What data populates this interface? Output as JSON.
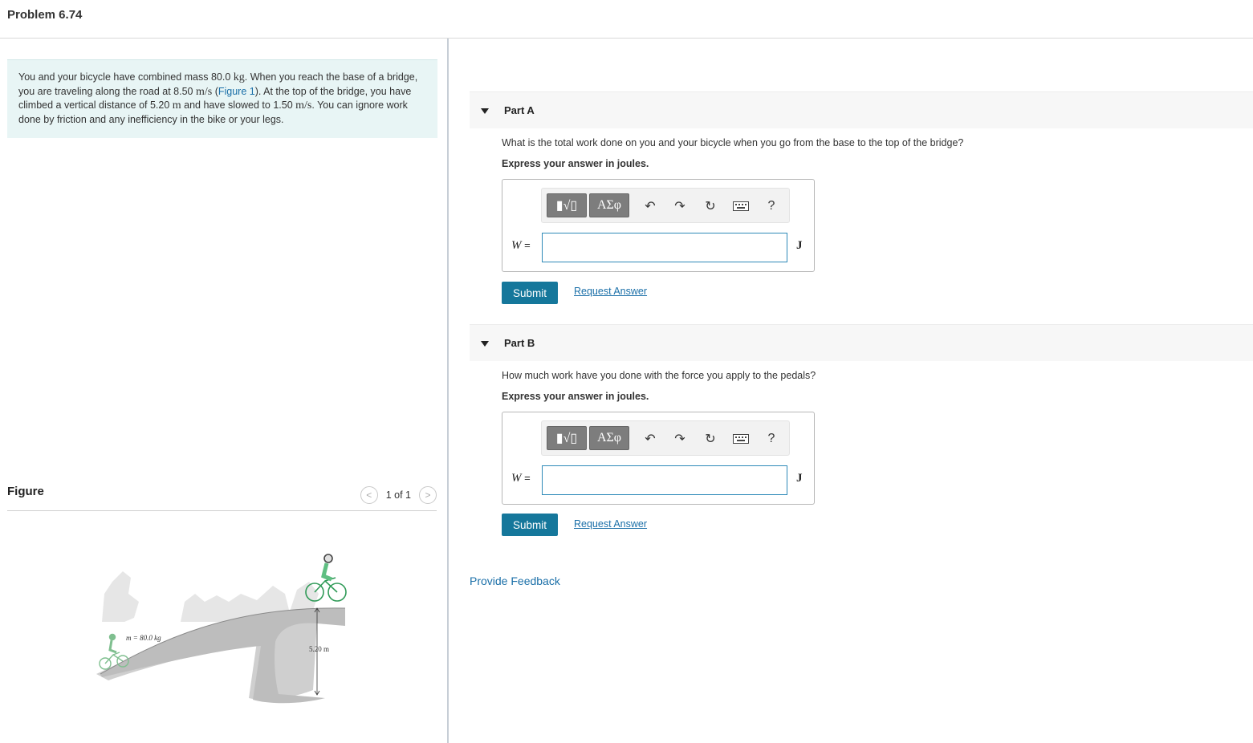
{
  "header": {
    "title": "Problem 6.74"
  },
  "intro": {
    "s1": "You and your bicycle have combined mass 80.0 ",
    "u_kg": "kg",
    "s2": ". When you reach the base of a bridge, you are traveling along the road at 8.50 ",
    "u_ms1": "m/s",
    "s3": " (",
    "figure_link": "Figure 1",
    "s4": "). At the top of the bridge, you have climbed a vertical distance of 5.20 ",
    "u_m": "m",
    "s5": " and have slowed to 1.50 ",
    "u_ms2": "m/s",
    "s6": ". You can ignore work done by friction and any inefficiency in the bike or your legs."
  },
  "figure": {
    "label": "Figure",
    "pager_text": "1 of 1",
    "prev_glyph": "<",
    "next_glyph": ">",
    "mass_label": "m = 80.0 kg",
    "height_label": "5.20 m"
  },
  "toolbar": {
    "templates_glyph": "▮√▯",
    "greek_glyph": "ΑΣφ",
    "undo_glyph": "↶",
    "redo_glyph": "↷",
    "reset_glyph": "↻",
    "help_glyph": "?",
    "icons": [
      "templates-icon",
      "greek-letters-icon",
      "undo-icon",
      "redo-icon",
      "reset-icon",
      "keyboard-icon",
      "help-icon"
    ]
  },
  "parts": [
    {
      "label": "Part A",
      "question": "What is the total work done on you and your bicycle when you go from the base to the top of the bridge?",
      "express": "Express your answer in joules.",
      "var_name": "W",
      "var_eq": " =",
      "input_value": "",
      "unit": "J",
      "submit": "Submit",
      "request": "Request Answer"
    },
    {
      "label": "Part B",
      "question": "How much work have you done with the force you apply to the pedals?",
      "express": "Express your answer in joules.",
      "var_name": "W",
      "var_eq": " =",
      "input_value": "",
      "unit": "J",
      "submit": "Submit",
      "request": "Request Answer"
    }
  ],
  "feedback": {
    "label": "Provide Feedback"
  },
  "colors": {
    "accent": "#15779b",
    "link": "#1a6fa8",
    "intro_bg": "#e8f5f5",
    "input_border": "#2e8ab8"
  }
}
